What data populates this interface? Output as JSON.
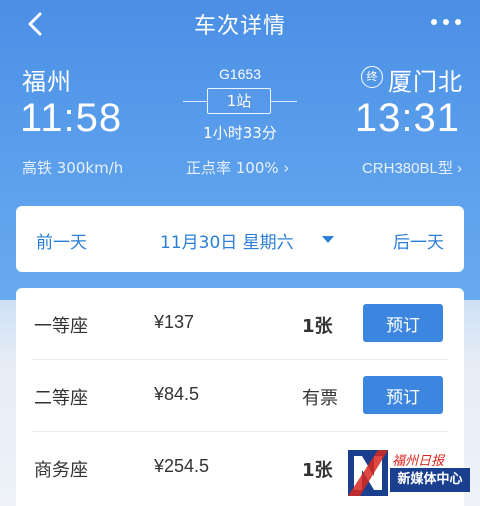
{
  "header": {
    "title": "车次详情",
    "back_icon": "chevron-left-icon",
    "more_icon": "more-dots-icon"
  },
  "train": {
    "number": "G1653",
    "departure": {
      "station": "福州",
      "time": "11:58"
    },
    "arrival": {
      "station": "厦门北",
      "time": "13:31",
      "badge": "终"
    },
    "stops": "1站",
    "duration": "1小时33分",
    "speed": "高铁 300km/h",
    "punctuality": "正点率 100% ›",
    "model": "CRH380BL型 ›"
  },
  "date_bar": {
    "prev_label": "前一天",
    "selected_date": "11月30日 星期六",
    "next_label": "后一天"
  },
  "seats": [
    {
      "name": "一等座",
      "price": "¥137",
      "availability": "1张",
      "button": "预订"
    },
    {
      "name": "二等座",
      "price": "¥84.5",
      "availability": "有票",
      "button": "预订"
    },
    {
      "name": "商务座",
      "price": "¥254.5",
      "availability": "1张",
      "button": ""
    }
  ],
  "watermark": {
    "top_text": "福州日报",
    "bottom_text": "新媒体中心"
  },
  "colors": {
    "header_blue": "#4b8fe6",
    "accent_blue": "#2b7fd6",
    "button_blue": "#3d86e0"
  }
}
